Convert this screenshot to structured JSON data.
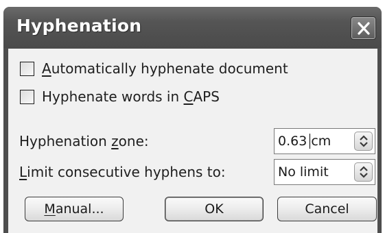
{
  "dialog": {
    "title": "Hyphenation",
    "close_label": "close"
  },
  "options": {
    "auto_hyphenate": {
      "prefix": "",
      "mnemonic": "A",
      "suffix": "utomatically hyphenate document",
      "checked": false
    },
    "hyphenate_caps": {
      "prefix": "Hyphenate words in ",
      "mnemonic": "C",
      "suffix": "APS",
      "checked": false
    }
  },
  "fields": {
    "zone": {
      "prefix": "Hyphenation ",
      "mnemonic": "z",
      "suffix": "one:",
      "value": "0.63 cm"
    },
    "limit": {
      "prefix": "",
      "mnemonic": "L",
      "suffix": "imit consecutive hyphens to:",
      "value": "No limit"
    }
  },
  "buttons": {
    "manual": {
      "prefix": "",
      "mnemonic": "M",
      "suffix": "anual..."
    },
    "ok": "OK",
    "cancel": "Cancel"
  },
  "colors": {
    "title_bar": "#4e4e4e",
    "client_bg": "#f1f1f1",
    "title_text": "#ffffff"
  }
}
